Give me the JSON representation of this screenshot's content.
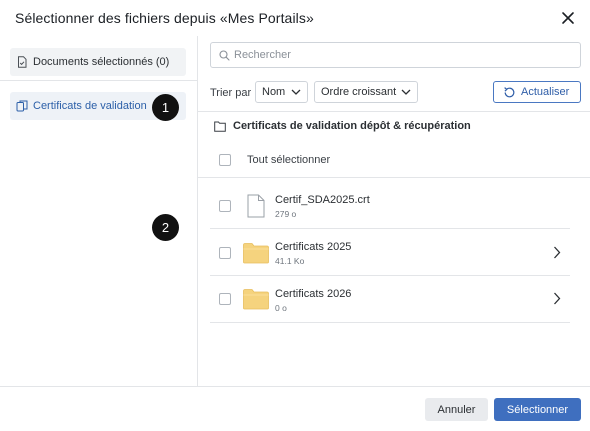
{
  "dialog": {
    "title": "Sélectionner des fichiers depuis «Mes Portails»",
    "close_icon": "close-icon"
  },
  "sidebar": {
    "items": [
      {
        "label": "Documents sélectionnés (0)",
        "icon": "document-check-icon"
      },
      {
        "label": "Certificats de validation",
        "icon": "copy-files-icon"
      }
    ]
  },
  "markers": [
    "1",
    "2"
  ],
  "search": {
    "placeholder": "Rechercher",
    "value": ""
  },
  "sort": {
    "label": "Trier par",
    "field": "Nom",
    "order": "Ordre croissant"
  },
  "refresh": {
    "label": "Actualiser",
    "icon": "refresh-icon"
  },
  "breadcrumb": {
    "label": "Certificats de validation dépôt & récupération",
    "icon": "folder-outline-icon"
  },
  "select_all": {
    "label": "Tout sélectionner"
  },
  "files": [
    {
      "name": "Certif_SDA2025.crt",
      "size": "279 o",
      "type": "file"
    },
    {
      "name": "Certificats 2025",
      "size": "41.1 Ko",
      "type": "folder"
    },
    {
      "name": "Certificats 2026",
      "size": "0 o",
      "type": "folder"
    }
  ],
  "footer": {
    "cancel": "Annuler",
    "select": "Sélectionner"
  },
  "colors": {
    "accent": "#3f6fbf",
    "folder": "#f7d57a",
    "selected_sidebar_bg": "#eef2f7"
  }
}
